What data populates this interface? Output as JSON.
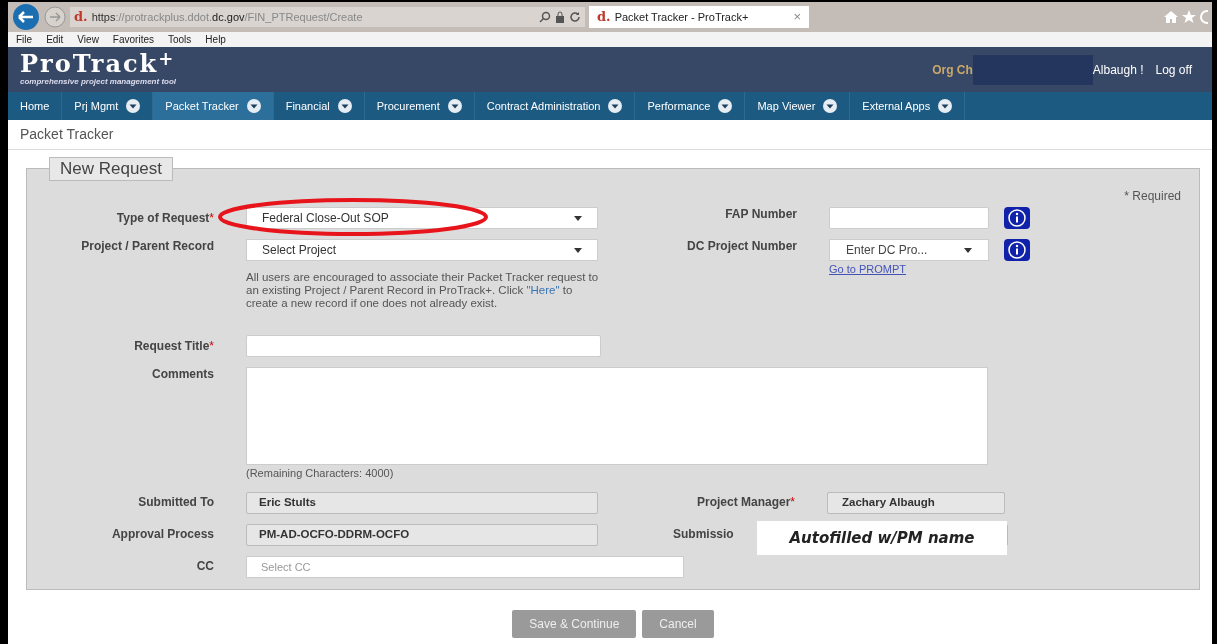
{
  "browser": {
    "favicon": "d.",
    "url_host": "https://protrackplus.ddot.",
    "url_domain": "dc.gov",
    "url_path": "/FIN_PTRequest/Create",
    "tab_favicon": "d.",
    "tab_title": "Packet Tracker - ProTrack+",
    "tab_close": "×"
  },
  "menu": [
    "File",
    "Edit",
    "View",
    "Favorites",
    "Tools",
    "Help"
  ],
  "header": {
    "logo": "ProTrack",
    "logo_sup": "+",
    "tagline": "comprehensive project management tool",
    "user_left": "Org Ch",
    "user_right": "Albaugh !",
    "logoff": "Log off"
  },
  "nav": [
    {
      "label": "Home",
      "dropdown": false,
      "selected": false
    },
    {
      "label": "Prj Mgmt",
      "dropdown": true,
      "selected": false
    },
    {
      "label": "Packet Tracker",
      "dropdown": true,
      "selected": true
    },
    {
      "label": "Financial",
      "dropdown": true,
      "selected": false
    },
    {
      "label": "Procurement",
      "dropdown": true,
      "selected": false
    },
    {
      "label": "Contract Administration",
      "dropdown": true,
      "selected": false
    },
    {
      "label": "Performance",
      "dropdown": true,
      "selected": false
    },
    {
      "label": "Map Viewer",
      "dropdown": true,
      "selected": false
    },
    {
      "label": "External Apps",
      "dropdown": true,
      "selected": false
    }
  ],
  "page_title": "Packet Tracker",
  "form": {
    "legend": "New Request",
    "required_mark": "*",
    "required_note": "* Required",
    "type_of_request": {
      "label": "Type of Request",
      "required": true,
      "value": "Federal Close-Out SOP"
    },
    "project": {
      "label": "Project / Parent Record",
      "required": false,
      "value": "Select Project"
    },
    "help_before": "All users are encouraged to associate their Packet Tracker request to an existing Project / Parent Record in ProTrack+. Click ",
    "help_link": "\"Here\"",
    "help_after": " to create a new record if one does not already exist.",
    "fap_number": {
      "label": "FAP Number",
      "required": false
    },
    "dc_project_number": {
      "label": "DC Project Number",
      "required": false,
      "placeholder": "Enter DC Pro...",
      "link": "Go to PROMPT"
    },
    "request_title": {
      "label": "Request Title",
      "required": true
    },
    "comments": {
      "label": "Comments",
      "required": false,
      "remaining": "(Remaining Characters: 4000)"
    },
    "submitted_to": {
      "label": "Submitted To",
      "required": false,
      "value": "Eric Stults"
    },
    "project_manager": {
      "label": "Project Manager",
      "required": true,
      "value": "Zachary Albaugh"
    },
    "approval_process": {
      "label": "Approval Process",
      "required": false,
      "value": "PM-AD-OCFO-DDRM-OCFO"
    },
    "submission": {
      "label": "Submissio",
      "required": false
    },
    "cc": {
      "label": "CC",
      "required": false,
      "placeholder": "Select CC"
    }
  },
  "callout": "Autofilled w/PM name",
  "buttons": [
    {
      "label": "Save & Continue"
    },
    {
      "label": "Cancel"
    }
  ]
}
